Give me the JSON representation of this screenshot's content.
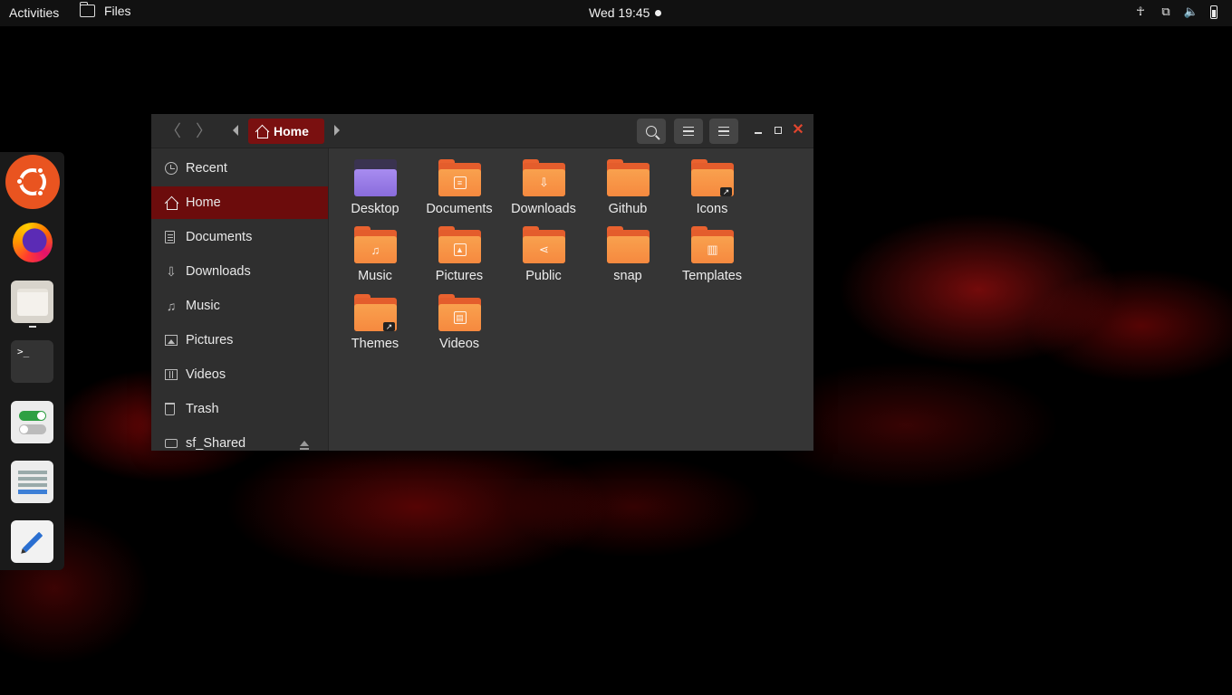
{
  "topbar": {
    "activities": "Activities",
    "app_name": "Files",
    "clock": "Wed 19:45",
    "tray_icons": [
      "accessibility-icon",
      "network-icon",
      "volume-icon",
      "battery-icon"
    ]
  },
  "dock": {
    "items": [
      "ubuntu-icon",
      "firefox-icon",
      "files-icon",
      "terminal-icon",
      "settings-icon",
      "software-icon",
      "text-editor-icon"
    ],
    "terminal_prompt": ">_"
  },
  "window": {
    "path_current": "Home",
    "sidebar": [
      {
        "label": "Recent",
        "icon": "clock-icon"
      },
      {
        "label": "Home",
        "icon": "home-icon",
        "active": true
      },
      {
        "label": "Documents",
        "icon": "document-icon"
      },
      {
        "label": "Downloads",
        "icon": "download-icon"
      },
      {
        "label": "Music",
        "icon": "music-icon"
      },
      {
        "label": "Pictures",
        "icon": "picture-icon"
      },
      {
        "label": "Videos",
        "icon": "video-icon"
      },
      {
        "label": "Trash",
        "icon": "trash-icon"
      },
      {
        "label": "sf_Shared",
        "icon": "drive-icon"
      }
    ],
    "files": [
      {
        "label": "Desktop"
      },
      {
        "label": "Documents"
      },
      {
        "label": "Downloads"
      },
      {
        "label": "Github"
      },
      {
        "label": "Icons"
      },
      {
        "label": "Music"
      },
      {
        "label": "Pictures"
      },
      {
        "label": "Public"
      },
      {
        "label": "snap"
      },
      {
        "label": "Templates"
      },
      {
        "label": "Themes"
      },
      {
        "label": "Videos"
      }
    ]
  },
  "colors": {
    "accent": "#6c0c0c",
    "folder": "#f6893f",
    "window_bg": "#353535",
    "close": "#e0452e"
  }
}
